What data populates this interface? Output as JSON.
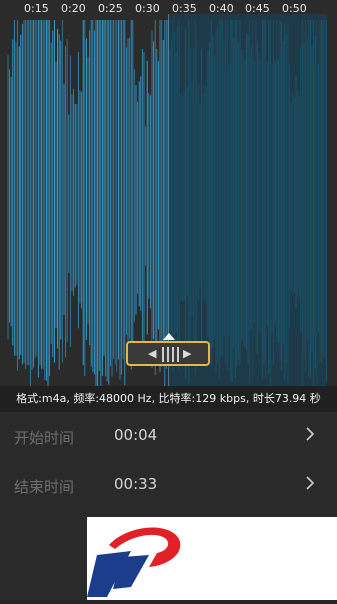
{
  "timeline": {
    "ticks": [
      "0:15",
      "0:20",
      "0:25",
      "0:30",
      "0:35",
      "0:40",
      "0:45",
      "0:50"
    ]
  },
  "waveform": {
    "colors": {
      "unselected": "#35aee6",
      "selected": "#1f7592",
      "selection_overlay": "#14465f",
      "handle_border": "#e6b83b"
    }
  },
  "info": {
    "text": "格式:m4a, 频率:48000 Hz, 比特率:129 kbps, 时长73.94 秒"
  },
  "start_time": {
    "label": "开始时间",
    "value": "00:04",
    "icon": "chevron-right-icon"
  },
  "end_time": {
    "label": "结束时间",
    "value": "00:33",
    "icon": "chevron-right-icon"
  },
  "handle": {
    "left_arrow": "◀",
    "right_arrow": "▶"
  }
}
